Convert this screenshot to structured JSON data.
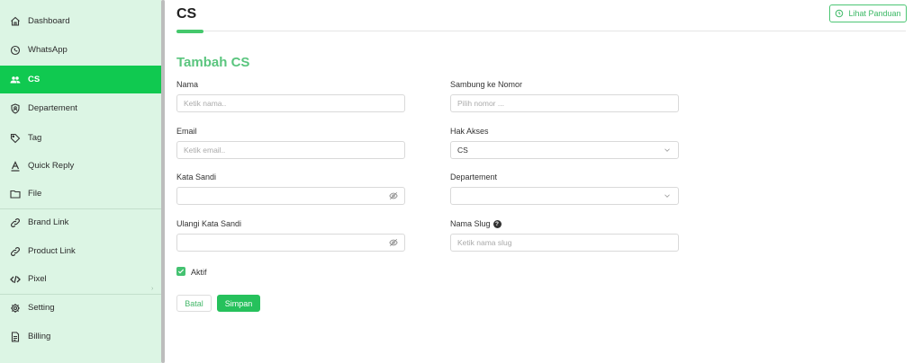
{
  "sidebar": {
    "items": [
      {
        "label": "Dashboard",
        "icon": "home-icon"
      },
      {
        "label": "WhatsApp",
        "icon": "whatsapp-icon"
      },
      {
        "label": "CS",
        "icon": "users-icon",
        "active": true
      },
      {
        "label": "Departement",
        "icon": "shield-icon"
      },
      {
        "label": "Tag",
        "icon": "tag-icon"
      },
      {
        "label": "Quick Reply",
        "icon": "quick-reply-icon"
      },
      {
        "label": "File",
        "icon": "folder-icon"
      },
      {
        "label": "Brand Link",
        "icon": "link-icon"
      },
      {
        "label": "Product Link",
        "icon": "link-icon"
      },
      {
        "label": "Pixel",
        "icon": "code-icon"
      },
      {
        "label": "Setting",
        "icon": "gear-icon"
      },
      {
        "label": "Billing",
        "icon": "document-icon"
      }
    ]
  },
  "header": {
    "title": "CS",
    "guide_button": "Lihat Panduan"
  },
  "form": {
    "heading": "Tambah CS",
    "nama": {
      "label": "Nama",
      "placeholder": "Ketik nama.."
    },
    "email": {
      "label": "Email",
      "placeholder": "Ketik email.."
    },
    "kata_sandi": {
      "label": "Kata Sandi"
    },
    "ulangi_kata_sandi": {
      "label": "Ulangi Kata Sandi"
    },
    "sambung_nomor": {
      "label": "Sambung ke Nomor",
      "placeholder": "Pilih nomor ..."
    },
    "hak_akses": {
      "label": "Hak Akses",
      "value": "CS"
    },
    "departement": {
      "label": "Departement",
      "value": ""
    },
    "nama_slug": {
      "label": "Nama Slug",
      "placeholder": "Ketik nama slug"
    },
    "aktif": {
      "label": "Aktif",
      "checked": true
    },
    "cancel_button": "Batal",
    "save_button": "Simpan"
  },
  "colors": {
    "accent": "#10c950",
    "sidebar_bg": "#dcf5e4",
    "heading": "#5ac57e"
  }
}
